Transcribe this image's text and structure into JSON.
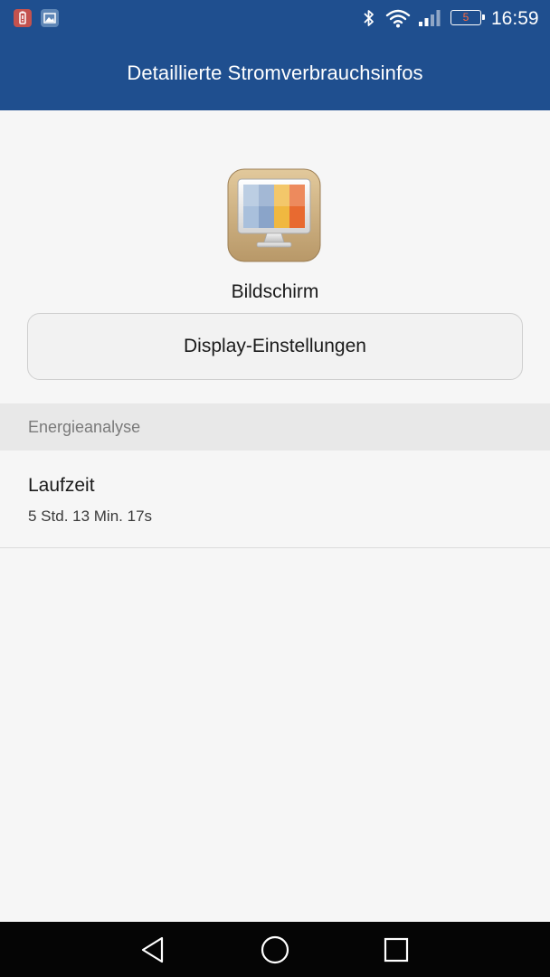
{
  "status_bar": {
    "time": "16:59",
    "battery_level": "5",
    "notification_icons": [
      "battery-alert-icon",
      "image-icon"
    ],
    "status_icons": [
      "bluetooth-icon",
      "wifi-icon",
      "signal-icon",
      "battery-icon"
    ]
  },
  "header": {
    "title": "Detaillierte Stromverbrauchsinfos"
  },
  "app": {
    "icon": "display-monitor-icon",
    "name": "Bildschirm",
    "settings_button_label": "Display-Einstellungen"
  },
  "energy_section": {
    "title": "Energieanalyse",
    "items": [
      {
        "label": "Laufzeit",
        "value": "5 Std. 13 Min. 17s"
      }
    ]
  },
  "nav_bar": {
    "buttons": [
      "back-icon",
      "home-icon",
      "recent-apps-icon"
    ]
  },
  "colors": {
    "primary": "#1f4f8f",
    "background": "#f6f6f6",
    "section_header_bg": "#e8e8e8",
    "battery_low": "#ff6a3d"
  }
}
